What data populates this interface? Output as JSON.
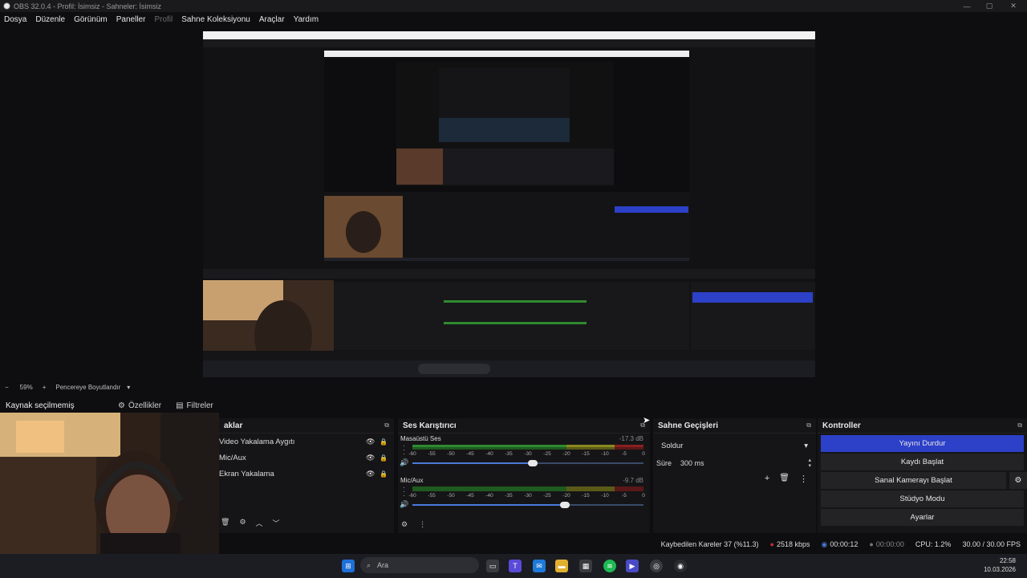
{
  "window": {
    "title": "OBS 32.0.4 - Profil: İsimsiz - Sahneler: İsimsiz"
  },
  "menu": [
    "Dosya",
    "Düzenle",
    "Görünüm",
    "Paneller",
    "Profil",
    "Sahne Koleksiyonu",
    "Araçlar",
    "Yardım"
  ],
  "menu_disabled": "Profil",
  "zoom": {
    "minus": "−",
    "value": "59%",
    "plus": "+",
    "mode": "Pencereye Boyutlandır"
  },
  "source_bar": {
    "no_selection": "Kaynak seçilmemiş",
    "properties": "Özellikler",
    "filters": "Filtreler"
  },
  "sources": {
    "title": "aklar",
    "items": [
      "Video Yakalama Aygıtı",
      "Mic/Aux",
      "Ekran Yakalama"
    ]
  },
  "mixer": {
    "title": "Ses Karıştırıcı",
    "tracks": [
      {
        "name": "Masaüstü Ses",
        "db": "-17.3 dB",
        "volume": 0.52
      },
      {
        "name": "Mic/Aux",
        "db": "-9.7 dB",
        "volume": 0.66
      }
    ],
    "ticks": [
      "-60",
      "-55",
      "-50",
      "-45",
      "-40",
      "-35",
      "-30",
      "-25",
      "-20",
      "-15",
      "-10",
      "-5",
      "0"
    ]
  },
  "transitions": {
    "title": "Sahne Geçişleri",
    "selected": "Soldur",
    "duration_label": "Süre",
    "duration_value": "300 ms"
  },
  "controls": {
    "title": "Kontroller",
    "buttons": [
      "Yayını Durdur",
      "Kaydı Başlat",
      "Sanal Kamerayı Başlat",
      "Stüdyo Modu",
      "Ayarlar"
    ]
  },
  "status": {
    "dropped": "Kaybedilen Kareler 37 (%11.3)",
    "bitrate": "2518 kbps",
    "stream_time": "00:00:12",
    "rec_time": "00:00:00",
    "cpu": "CPU: 1.2%",
    "fps": "30.00 / 30.00 FPS"
  },
  "taskbar": {
    "search": "Ara",
    "time": "22:58",
    "date": "10.03.2026"
  },
  "colors": {
    "accent": "#2c40c8",
    "meter_green": "#2f8a2f",
    "meter_yellow": "#8a8a20",
    "meter_red": "#8a2020"
  }
}
